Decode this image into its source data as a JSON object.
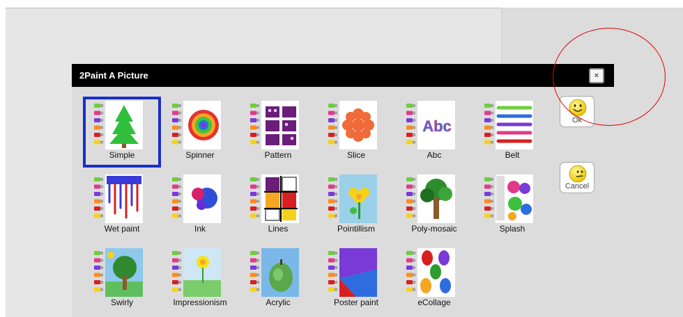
{
  "dialog": {
    "title": "2Paint A Picture",
    "close_label": "×"
  },
  "actions": {
    "ok_label": "Ok",
    "cancel_label": "Cancel"
  },
  "tiles": [
    {
      "label": "Simple",
      "icon": "tree-icon"
    },
    {
      "label": "Spinner",
      "icon": "spinner-icon"
    },
    {
      "label": "Pattern",
      "icon": "pattern-icon"
    },
    {
      "label": "Slice",
      "icon": "slice-icon"
    },
    {
      "label": "Abc",
      "icon": "abc-icon"
    },
    {
      "label": "Belt",
      "icon": "belt-icon"
    },
    {
      "label": "Wet paint",
      "icon": "wet-paint-icon"
    },
    {
      "label": "Ink",
      "icon": "ink-icon"
    },
    {
      "label": "Lines",
      "icon": "lines-icon"
    },
    {
      "label": "Pointillism",
      "icon": "pointillism-icon"
    },
    {
      "label": "Poly-mosaic",
      "icon": "poly-mosaic-icon"
    },
    {
      "label": "Splash",
      "icon": "splash-icon"
    },
    {
      "label": "Swirly",
      "icon": "swirly-icon"
    },
    {
      "label": "Impressionism",
      "icon": "impressionism-icon"
    },
    {
      "label": "Acrylic",
      "icon": "acrylic-icon"
    },
    {
      "label": "Poster paint",
      "icon": "poster-paint-icon"
    },
    {
      "label": "eCollage",
      "icon": "ecollage-icon"
    }
  ],
  "icons": {
    "abc_text": "Abc"
  },
  "colors": {
    "selection": "#1a2ec8",
    "annotation": "#e00000",
    "titlebar": "#000000"
  }
}
